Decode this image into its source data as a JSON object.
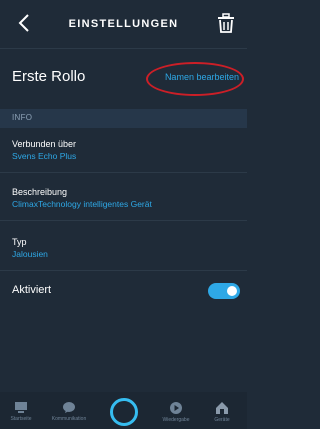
{
  "header": {
    "title": "EINSTELLUNGEN"
  },
  "device": {
    "name": "Erste Rollo",
    "rename_label": "Namen bearbeiten"
  },
  "section": {
    "info_label": "INFO"
  },
  "rows": [
    {
      "label": "Verbunden über",
      "value": "Svens Echo Plus"
    },
    {
      "label": "Beschreibung",
      "value": "ClimaxTechnology intelligentes Gerät"
    },
    {
      "label": "Typ",
      "value": "Jalousien"
    }
  ],
  "activated": {
    "label": "Aktiviert",
    "enabled": true
  },
  "nav": {
    "items": [
      {
        "label": "Startseite",
        "icon": "home-icon"
      },
      {
        "label": "Kommunikation",
        "icon": "chat-bubble-icon"
      },
      {
        "label": "",
        "icon": "alexa-icon"
      },
      {
        "label": "Wiedergabe",
        "icon": "play-icon"
      },
      {
        "label": "Geräte",
        "icon": "devices-icon"
      }
    ]
  },
  "colors": {
    "background": "#1f2b38",
    "accent": "#2ea8e6",
    "annotation_circle": "#cc1f27"
  }
}
